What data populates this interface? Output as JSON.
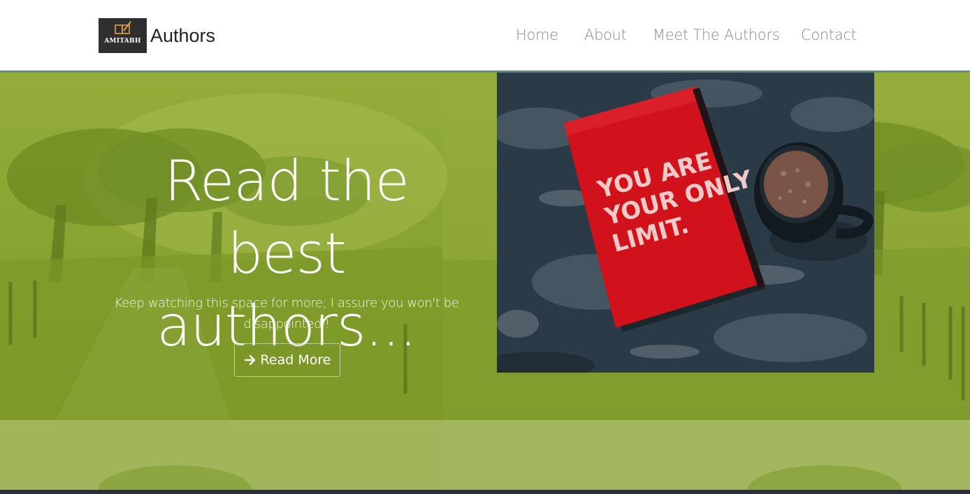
{
  "nav": {
    "logo_text": "AMITABH",
    "brand": "Authors",
    "links": [
      "Home",
      "About",
      "Meet The Authors",
      "Contact"
    ]
  },
  "hero": {
    "title_line1": "Read the best",
    "title_line2": "authors...",
    "subtitle": "Keep watching this space for more; I assure you won't be disappointed'!",
    "button_label": "Read More",
    "button_icon": "arrow-right-icon",
    "photo": {
      "notebook_line1": "YOU ARE",
      "notebook_line2": "YOUR ONLY",
      "notebook_line3": "LIMIT."
    }
  },
  "colors": {
    "nav_bg": "#ffffff",
    "nav_border": "#5e8f86",
    "hero_overlay": "#8aa432",
    "notebook_red": "#d1121a",
    "footer_bar": "#2c3136"
  }
}
